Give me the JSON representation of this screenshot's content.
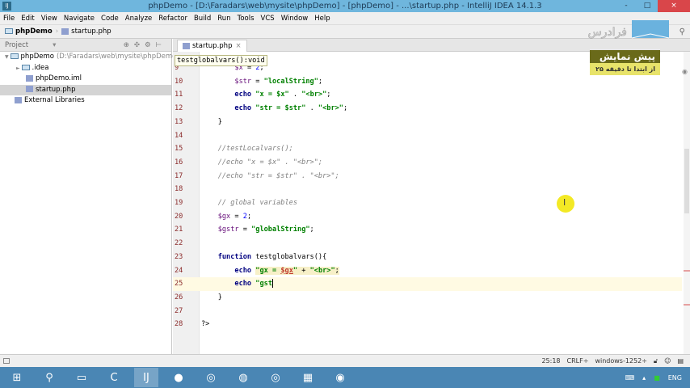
{
  "window": {
    "title": "phpDemo - [D:\\Faradars\\web\\mysite\\phpDemo] - [phpDemo] - ...\\startup.php - IntelliJ IDEA 14.1.3",
    "minimize": "-",
    "maximize": "□",
    "close": "×"
  },
  "menu": [
    "File",
    "Edit",
    "View",
    "Navigate",
    "Code",
    "Analyze",
    "Refactor",
    "Build",
    "Run",
    "Tools",
    "VCS",
    "Window",
    "Help"
  ],
  "breadcrumb": {
    "project": "phpDemo",
    "file": "startup.php"
  },
  "sidebar": {
    "header": "Project",
    "tree": [
      {
        "label": "phpDemo",
        "path": "(D:\\Faradars\\web\\mysite\\phpDemo)",
        "arrow": "▼",
        "icon": "folder-icon"
      },
      {
        "label": ".idea",
        "arrow": "►",
        "icon": "folder-icon"
      },
      {
        "label": "phpDemo.iml",
        "icon": "module-icon"
      },
      {
        "label": "startup.php",
        "icon": "php-file-icon",
        "selected": true
      },
      {
        "label": "External Libraries",
        "icon": "library-icon"
      }
    ]
  },
  "editor": {
    "tab": "startup.php",
    "tab_close": "×",
    "tooltip": "testglobalvars():void",
    "current_line": 25,
    "lines": [
      {
        "n": "9",
        "t": [
          [
            "",
            "        "
          ],
          [
            "var",
            "$x"
          ],
          [
            "",
            " = "
          ],
          [
            "num",
            "2"
          ],
          [
            "",
            ";"
          ]
        ]
      },
      {
        "n": "10",
        "t": [
          [
            "",
            "        "
          ],
          [
            "var",
            "$str"
          ],
          [
            "",
            " = "
          ],
          [
            "str",
            "\"localString\""
          ],
          [
            "",
            ";"
          ]
        ]
      },
      {
        "n": "11",
        "t": [
          [
            "",
            "        "
          ],
          [
            "kw",
            "echo"
          ],
          [
            "",
            " "
          ],
          [
            "str",
            "\"x = $x\""
          ],
          [
            "",
            " . "
          ],
          [
            "str",
            "\"<br>\""
          ],
          [
            "",
            ";"
          ]
        ]
      },
      {
        "n": "12",
        "t": [
          [
            "",
            "        "
          ],
          [
            "kw",
            "echo"
          ],
          [
            "",
            " "
          ],
          [
            "str",
            "\"str = $str\""
          ],
          [
            "",
            " . "
          ],
          [
            "str",
            "\"<br>\""
          ],
          [
            "",
            ";"
          ]
        ]
      },
      {
        "n": "13",
        "t": [
          [
            "",
            "    }"
          ]
        ]
      },
      {
        "n": "14",
        "t": []
      },
      {
        "n": "15",
        "t": [
          [
            "",
            "    "
          ],
          [
            "cm",
            "//testLocalvars();"
          ]
        ]
      },
      {
        "n": "16",
        "t": [
          [
            "",
            "    "
          ],
          [
            "cm",
            "//echo \"x = $x\" . \"<br>\";"
          ]
        ]
      },
      {
        "n": "17",
        "t": [
          [
            "",
            "    "
          ],
          [
            "cm",
            "//echo \"str = $str\" . \"<br>\";"
          ]
        ]
      },
      {
        "n": "18",
        "t": []
      },
      {
        "n": "19",
        "t": [
          [
            "",
            "    "
          ],
          [
            "cm",
            "// global variables"
          ]
        ]
      },
      {
        "n": "20",
        "t": [
          [
            "",
            "    "
          ],
          [
            "var",
            "$gx"
          ],
          [
            "",
            " = "
          ],
          [
            "num",
            "2"
          ],
          [
            "",
            ";"
          ]
        ]
      },
      {
        "n": "21",
        "t": [
          [
            "",
            "    "
          ],
          [
            "var",
            "$gstr"
          ],
          [
            "",
            " = "
          ],
          [
            "str",
            "\"globalString\""
          ],
          [
            "",
            ";"
          ]
        ]
      },
      {
        "n": "22",
        "t": []
      },
      {
        "n": "23",
        "t": [
          [
            "",
            "    "
          ],
          [
            "kw",
            "function"
          ],
          [
            "",
            " testglobalvars(){"
          ]
        ]
      },
      {
        "n": "24",
        "t": [
          [
            "",
            "        "
          ],
          [
            "kw",
            "echo"
          ],
          [
            "",
            " "
          ],
          [
            "str hl",
            "\"gx = "
          ],
          [
            "str hl err",
            "$gx"
          ],
          [
            "str hl",
            "\""
          ],
          [
            "hl",
            " + "
          ],
          [
            "str hl",
            "\"<br>\""
          ],
          [
            "hl",
            ";"
          ]
        ]
      },
      {
        "n": "25",
        "t": [
          [
            "",
            "        "
          ],
          [
            "kw",
            "echo"
          ],
          [
            "",
            " "
          ],
          [
            "str",
            "\"gst"
          ],
          [
            "caret",
            ""
          ]
        ]
      },
      {
        "n": "26",
        "t": [
          [
            "",
            "    }"
          ]
        ]
      },
      {
        "n": "27",
        "t": []
      },
      {
        "n": "28",
        "t": [
          [
            "",
            "?>"
          ]
        ]
      }
    ]
  },
  "watermark": {
    "brand": "فرادرس",
    "promo_title": "پیش نمایش",
    "promo_sub": "از ابتدا تا دقیقه ۲۵",
    "promo_dark": "#6a6a1a",
    "promo_light": "#e8e36a"
  },
  "status": {
    "position": "25:18",
    "line_sep": "CRLF÷",
    "encoding": "windows-1252÷"
  },
  "taskbar": {
    "apps": [
      "windows-start-icon",
      "search-icon",
      "file-explorer-icon",
      "camtasia-icon",
      "intellij-icon",
      "firefox-icon",
      "app-icon",
      "media-icon",
      "app-icon-2",
      "spreadsheet-icon",
      "chrome-icon"
    ],
    "lang": "ENG"
  }
}
